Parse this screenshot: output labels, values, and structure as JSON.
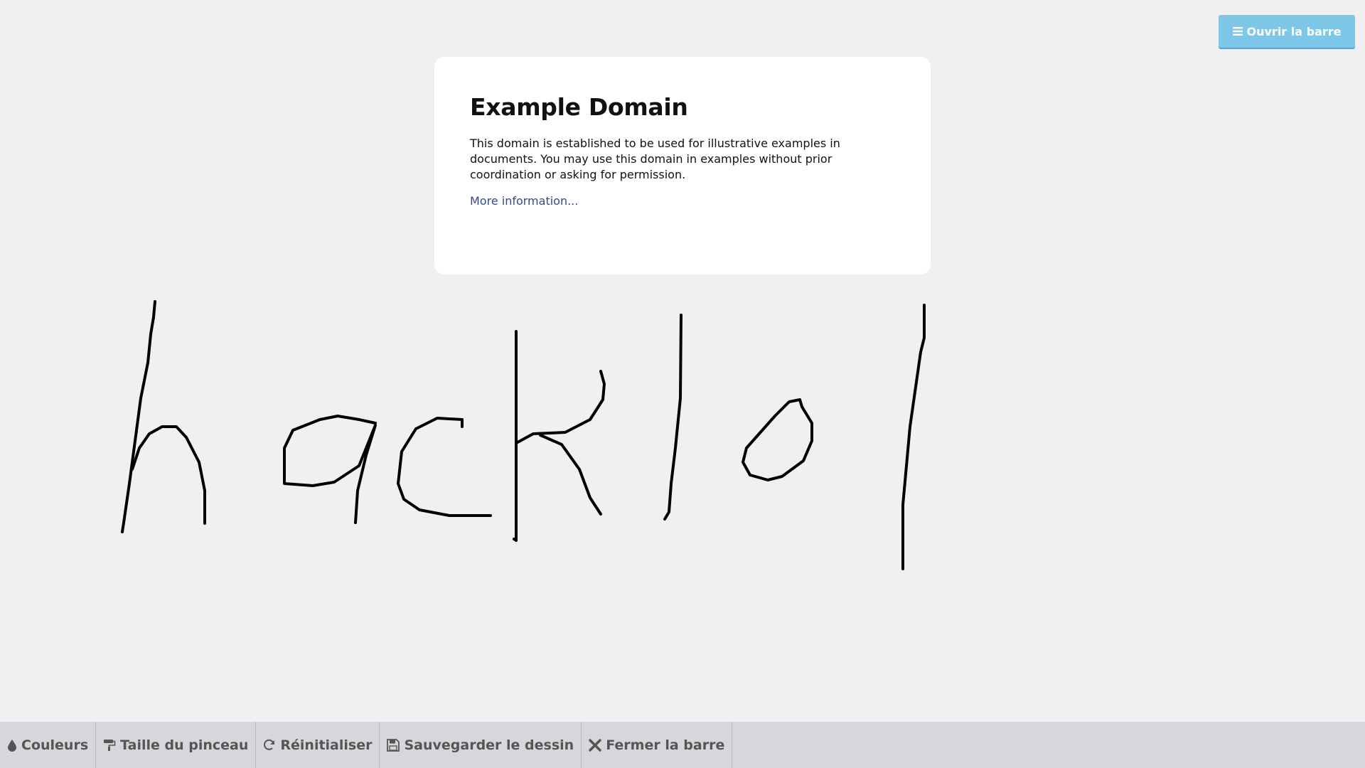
{
  "header": {
    "open_bar_label": "Ouvrir la barre",
    "open_bar_icon": "bars-icon"
  },
  "page": {
    "title": "Example Domain",
    "paragraph": "This domain is established to be used for illustrative examples in documents. You may use this domain in examples without prior coordination or asking for permission.",
    "link_text": "More information..."
  },
  "toolbar": {
    "items": [
      {
        "label": "Couleurs",
        "icon": "droplet-icon"
      },
      {
        "label": "Taille du pinceau",
        "icon": "paint-roller-icon"
      },
      {
        "label": "Réinitialiser",
        "icon": "refresh-icon"
      },
      {
        "label": "Sauvegarder le dessin",
        "icon": "save-icon"
      },
      {
        "label": "Fermer la barre",
        "icon": "close-icon"
      }
    ]
  },
  "colors": {
    "page_background": "#f0f0f2",
    "open_bar_button": "#7fc7e8",
    "toolbar_background": "#d5d7da",
    "toolbar_text": "#555555",
    "link": "#38488f",
    "ink": "#000000"
  }
}
